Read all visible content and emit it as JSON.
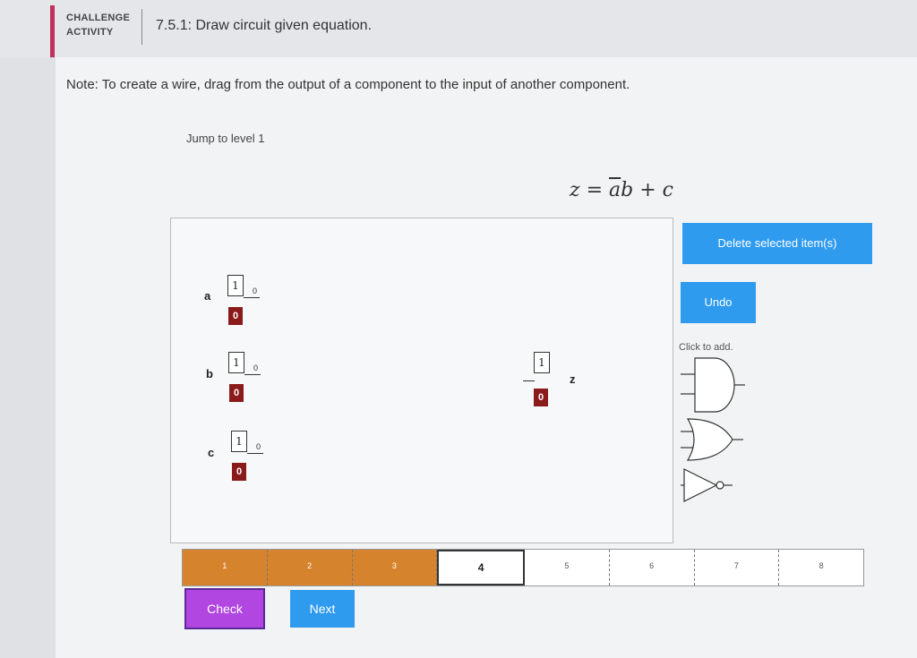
{
  "header": {
    "challenge_label_line1": "CHALLENGE",
    "challenge_label_line2": "ACTIVITY",
    "activity_title": "7.5.1: Draw circuit given equation."
  },
  "note": "Note: To create a wire, drag from the output of a component to the input of another component.",
  "jump_link": "Jump to level 1",
  "equation": {
    "lhs": "z",
    "eq": "=",
    "a_bar": "a",
    "rest": "b + c"
  },
  "inputs": [
    {
      "name": "a",
      "toggle_on": "1",
      "toggle_off": "0",
      "value": "0"
    },
    {
      "name": "b",
      "toggle_on": "1",
      "toggle_off": "0",
      "value": "0"
    },
    {
      "name": "c",
      "toggle_on": "1",
      "toggle_off": "0",
      "value": "0"
    }
  ],
  "output": {
    "name": "z",
    "top_value": "1",
    "value": "0"
  },
  "toolbar": {
    "delete_label": "Delete selected item(s)",
    "undo_label": "Undo",
    "click_to_add": "Click to add."
  },
  "gates": [
    "and-gate-icon",
    "or-gate-icon",
    "not-gate-icon"
  ],
  "levels": {
    "items": [
      "1",
      "2",
      "3",
      "4",
      "5",
      "6",
      "7",
      "8"
    ],
    "completed_count": 3,
    "current": "4"
  },
  "buttons": {
    "check_label": "Check",
    "next_label": "Next"
  },
  "colors": {
    "accent": "#c0305a",
    "primary": "#2e9bef",
    "level_done": "#d6832e",
    "check": "#b146e0",
    "switch_output": "#8b1a1a"
  }
}
